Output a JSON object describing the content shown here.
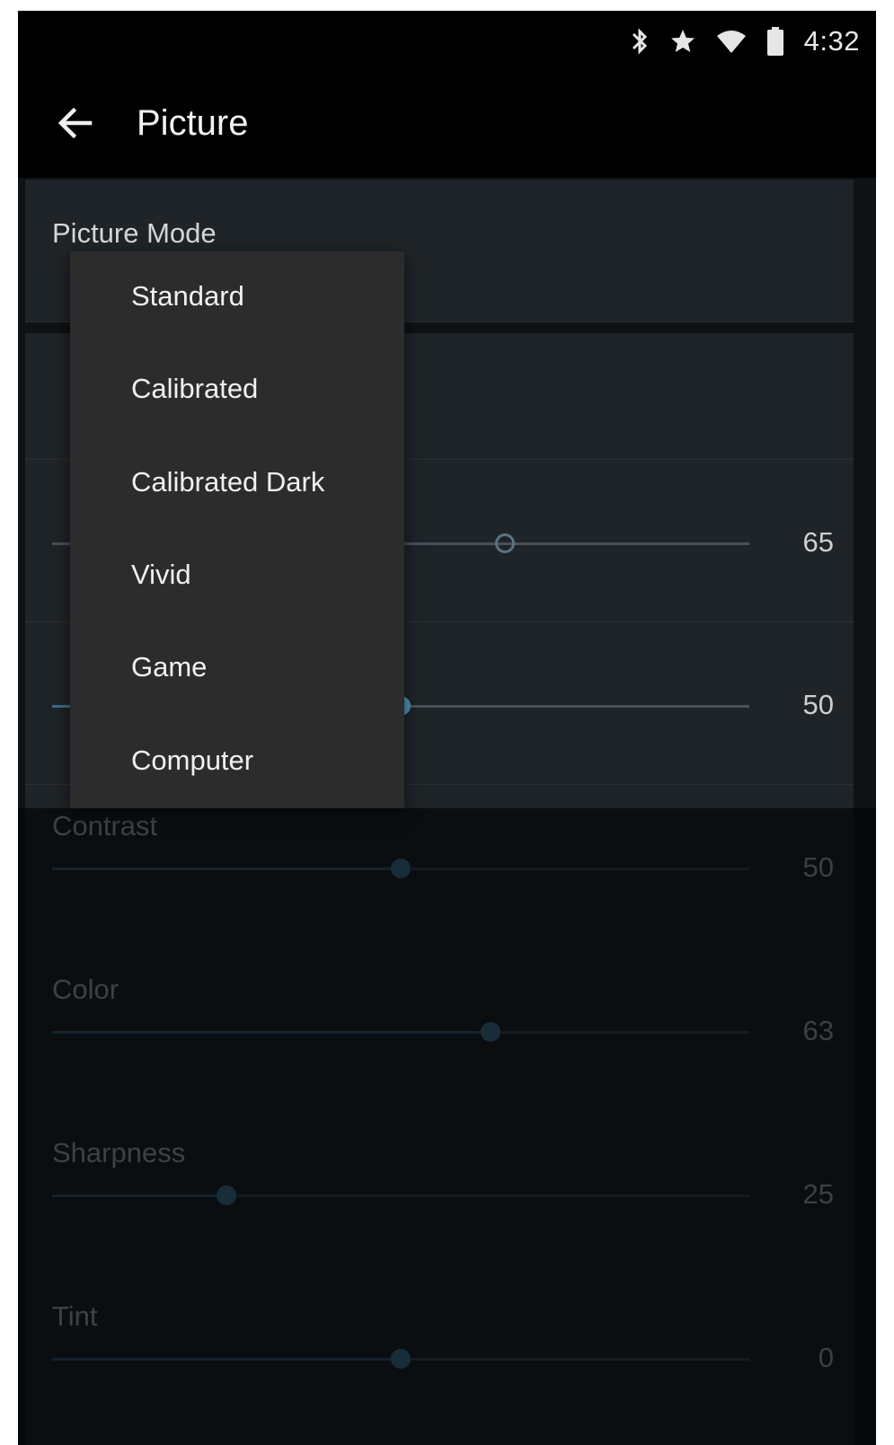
{
  "status_bar": {
    "time": "4:32",
    "icons": [
      "bluetooth-icon",
      "star-icon",
      "wifi-icon",
      "battery-icon"
    ]
  },
  "app_bar": {
    "title": "Picture",
    "back_icon": "arrow-left-icon"
  },
  "settings": {
    "picture_mode_label": "Picture Mode",
    "picture_mode_value": "",
    "sliders": [
      {
        "label": "",
        "value": "65",
        "level": 0.65,
        "style": "hollow"
      },
      {
        "label": "",
        "value": "50",
        "level": 0.5,
        "style": "active"
      },
      {
        "label": "Contrast",
        "value": "50",
        "level": 0.5,
        "style": "dimmed"
      },
      {
        "label": "Color",
        "value": "63",
        "level": 0.63,
        "style": "dimmed"
      },
      {
        "label": "Sharpness",
        "value": "25",
        "level": 0.25,
        "style": "dimmed"
      },
      {
        "label": "Tint",
        "value": "0",
        "level": 0.5,
        "style": "dimmed"
      }
    ]
  },
  "dropdown": {
    "options": [
      "Standard",
      "Calibrated",
      "Calibrated Dark",
      "Vivid",
      "Game",
      "Computer"
    ]
  },
  "colors": {
    "accent": "#4e95b9",
    "menu_background": "#2c2c2d",
    "screen_background": "#0c0f12"
  }
}
